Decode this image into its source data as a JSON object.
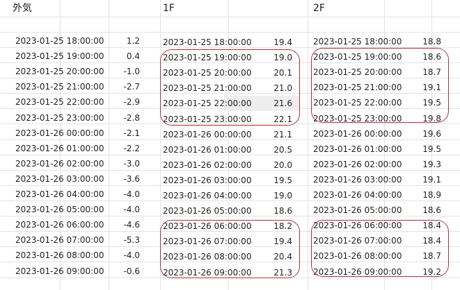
{
  "sheet": {
    "headers": {
      "outside": "外気",
      "floor1": "1F",
      "floor2": "2F"
    },
    "outside": [
      {
        "time": "2023-01-25 18:00:00",
        "value": "1.2"
      },
      {
        "time": "2023-01-25 19:00:00",
        "value": "0.4"
      },
      {
        "time": "2023-01-25 20:00:00",
        "value": "-1.0"
      },
      {
        "time": "2023-01-25 21:00:00",
        "value": "-2.7"
      },
      {
        "time": "2023-01-25 22:00:00",
        "value": "-2.9"
      },
      {
        "time": "2023-01-25 23:00:00",
        "value": "-2.8"
      },
      {
        "time": "2023-01-26 00:00:00",
        "value": "-2.1"
      },
      {
        "time": "2023-01-26 01:00:00",
        "value": "-2.2"
      },
      {
        "time": "2023-01-26 02:00:00",
        "value": "-3.0"
      },
      {
        "time": "2023-01-26 03:00:00",
        "value": "-3.6"
      },
      {
        "time": "2023-01-26 04:00:00",
        "value": "-4.0"
      },
      {
        "time": "2023-01-26 05:00:00",
        "value": "-4.0"
      },
      {
        "time": "2023-01-26 06:00:00",
        "value": "-4.6"
      },
      {
        "time": "2023-01-26 07:00:00",
        "value": "-5.3"
      },
      {
        "time": "2023-01-26 08:00:00",
        "value": "-4.0"
      },
      {
        "time": "2023-01-26 09:00:00",
        "value": "-0.6"
      }
    ],
    "floor1": [
      {
        "time": "2023-01-25 18:00:00",
        "value": "19.4"
      },
      {
        "time": "2023-01-25 19:00:00",
        "value": "19.0"
      },
      {
        "time": "2023-01-25 20:00:00",
        "value": "20.1"
      },
      {
        "time": "2023-01-25 21:00:00",
        "value": "21.0"
      },
      {
        "time": "2023-01-25 22:00:00",
        "value": "21.6"
      },
      {
        "time": "2023-01-25 23:00:00",
        "value": "22.1"
      },
      {
        "time": "2023-01-26 00:00:00",
        "value": "21.1"
      },
      {
        "time": "2023-01-26 01:00:00",
        "value": "20.5"
      },
      {
        "time": "2023-01-26 02:00:00",
        "value": "20.0"
      },
      {
        "time": "2023-01-26 03:00:00",
        "value": "19.5"
      },
      {
        "time": "2023-01-26 04:00:00",
        "value": "19.0"
      },
      {
        "time": "2023-01-26 05:00:00",
        "value": "18.6"
      },
      {
        "time": "2023-01-26 06:00:00",
        "value": "18.2"
      },
      {
        "time": "2023-01-26 07:00:00",
        "value": "19.4"
      },
      {
        "time": "2023-01-26 08:00:00",
        "value": "20.4"
      },
      {
        "time": "2023-01-26 09:00:00",
        "value": "21.3"
      }
    ],
    "floor2": [
      {
        "time": "2023-01-25 18:00:00",
        "value": "18.8"
      },
      {
        "time": "2023-01-25 19:00:00",
        "value": "18.6"
      },
      {
        "time": "2023-01-25 20:00:00",
        "value": "18.7"
      },
      {
        "time": "2023-01-25 21:00:00",
        "value": "19.1"
      },
      {
        "time": "2023-01-25 22:00:00",
        "value": "19.5"
      },
      {
        "time": "2023-01-25 23:00:00",
        "value": "19.8"
      },
      {
        "time": "2023-01-26 00:00:00",
        "value": "19.6"
      },
      {
        "time": "2023-01-26 01:00:00",
        "value": "19.5"
      },
      {
        "time": "2023-01-26 02:00:00",
        "value": "19.3"
      },
      {
        "time": "2023-01-26 03:00:00",
        "value": "19.1"
      },
      {
        "time": "2023-01-26 04:00:00",
        "value": "18.9"
      },
      {
        "time": "2023-01-26 05:00:00",
        "value": "18.6"
      },
      {
        "time": "2023-01-26 06:00:00",
        "value": "18.4"
      },
      {
        "time": "2023-01-26 07:00:00",
        "value": "18.4"
      },
      {
        "time": "2023-01-26 08:00:00",
        "value": "18.7"
      },
      {
        "time": "2023-01-26 09:00:00",
        "value": "19.2"
      }
    ],
    "annotation_color": "#b0303a",
    "gridline_color": "#e3e3e3"
  }
}
